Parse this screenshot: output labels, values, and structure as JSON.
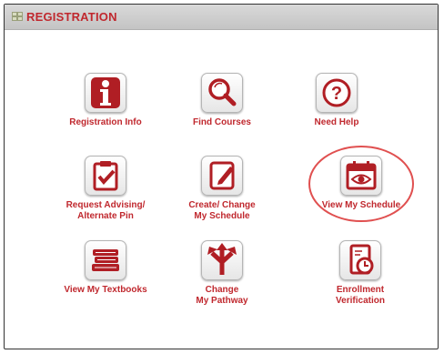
{
  "header": {
    "title": "REGISTRATION"
  },
  "tiles": {
    "registration_info": {
      "label": "Registration Info"
    },
    "find_courses": {
      "label": "Find Courses"
    },
    "need_help": {
      "label": "Need Help"
    },
    "request_advising": {
      "label_line1": "Request Advising/",
      "label_line2": "Alternate Pin"
    },
    "create_change_schedule": {
      "label_line1": "Create/ Change",
      "label_line2": "My Schedule"
    },
    "view_my_schedule": {
      "label": "View My Schedule"
    },
    "view_my_textbooks": {
      "label": "View My Textbooks"
    },
    "change_my_pathway": {
      "label_line1": "Change",
      "label_line2": "My Pathway"
    },
    "enrollment_verification": {
      "label_line1": "Enrollment",
      "label_line2": "Verification"
    }
  },
  "colors": {
    "accent": "#c0282e",
    "highlight_ring": "#e05050"
  },
  "icons": [
    "info-icon",
    "magnifier-icon",
    "question-icon",
    "clipboard-check-icon",
    "pencil-edit-icon",
    "calendar-eye-icon",
    "books-icon",
    "arrows-pathway-icon",
    "document-clock-icon"
  ]
}
